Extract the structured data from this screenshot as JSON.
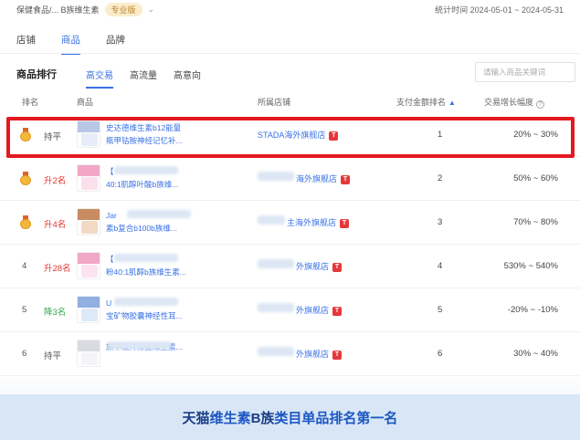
{
  "topbar": {
    "crumb": "保健食品/... B族维生素",
    "edition": "专业版",
    "date_label": "统计时间",
    "date_range": "2024-05-01 ~ 2024-05-31"
  },
  "main_tabs": [
    {
      "label": "店铺",
      "active": false
    },
    {
      "label": "商品",
      "active": true
    },
    {
      "label": "品牌",
      "active": false
    }
  ],
  "ranking": {
    "title": "商品排行",
    "subtabs": [
      {
        "label": "高交易",
        "active": true
      },
      {
        "label": "高流量",
        "active": false
      },
      {
        "label": "高意向",
        "active": false
      }
    ],
    "search_placeholder": "请输入商品关键词"
  },
  "table": {
    "headers": {
      "rank": "排名",
      "product": "商品",
      "store": "所属店铺",
      "pay_rank": "支付金额排名",
      "growth": "交易增长幅度"
    },
    "rows": [
      {
        "rank": "1",
        "medal": true,
        "change": "持平",
        "change_color": "#555555",
        "name_line1": "史达德维生素b12能量",
        "name_line2": "瓶甲钴胺神经记忆补...",
        "store": "STADA海外旗舰店",
        "pay_rank": "1",
        "growth": "20% ~ 30%",
        "thumb_colors": [
          "#b9c7e6",
          "#e7edf8"
        ]
      },
      {
        "rank": "2",
        "medal": true,
        "change": "升2名",
        "change_color": "#e2362f",
        "name_line1": "【",
        "name_line2": "40:1肌醇叶酸b族维...",
        "store": "海外旗舰店",
        "pay_rank": "2",
        "growth": "50% ~ 60%",
        "thumb_colors": [
          "#f3a7c7",
          "#fbe0ec"
        ]
      },
      {
        "rank": "3",
        "medal": true,
        "change": "升4名",
        "change_color": "#e2362f",
        "name_line1": "Jar",
        "name_line2": "素b复合b100b族维...",
        "store": "主海外旗舰店",
        "pay_rank": "3",
        "growth": "70% ~ 80%",
        "thumb_colors": [
          "#c98b62",
          "#f2d9c4"
        ]
      },
      {
        "rank": "4",
        "medal": false,
        "change": "升28名",
        "change_color": "#e2362f",
        "name_line1": "【",
        "name_line2": "粉40:1肌醇b族维生素...",
        "store": "外旗舰店",
        "pay_rank": "4",
        "growth": "530% ~ 540%",
        "thumb_colors": [
          "#f3a7c7",
          "#fde3ef"
        ]
      },
      {
        "rank": "5",
        "medal": false,
        "change": "降3名",
        "change_color": "#2fa84f",
        "name_line1": "U",
        "name_line2": "宝矿物胶囊神经性耳...",
        "store": "外旗舰店",
        "pay_rank": "5",
        "growth": "-20% ~ -10%",
        "thumb_colors": [
          "#8fb0e0",
          "#dde8f8"
        ]
      },
      {
        "rank": "6",
        "medal": false,
        "change": "持平",
        "change_color": "#555555",
        "name_line1": "",
        "name_line2": "族甲酸片修复维生素...",
        "store": "外旗舰店",
        "pay_rank": "6",
        "growth": "30% ~ 40%",
        "thumb_colors": [
          "#d9dbe0",
          "#f4f5f8"
        ]
      }
    ]
  },
  "banner": {
    "brand": "天猫",
    "text_part1": "维生素",
    "text_bold": "B族",
    "text_part2": "类目单品排名第一名"
  },
  "colors": {
    "accent": "#3a72e6",
    "highlight": "#e4191f",
    "up": "#e2362f",
    "down": "#2fa84f",
    "banner_bg": "#d8e6f6"
  }
}
